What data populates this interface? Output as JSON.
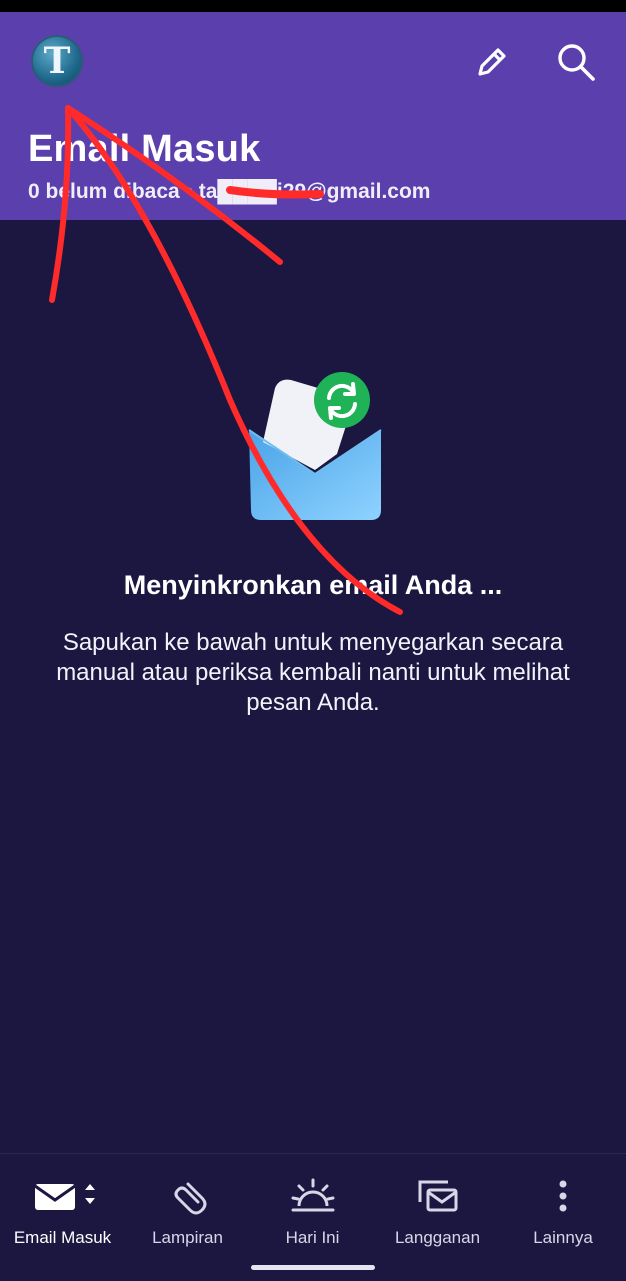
{
  "header": {
    "avatar_letter": "T",
    "title": "Email Masuk",
    "subtitle": "0 belum dibaca • ta████i29@gmail.com",
    "compose_icon": "pencil-icon",
    "search_icon": "search-icon",
    "background_color": "#5b3fad"
  },
  "main": {
    "illustration_icon": "envelope-sync-icon",
    "title": "Menyinkronkan email Anda ...",
    "description": "Sapukan ke bawah untuk menyegarkan secara manual atau periksa kembali nanti untuk melihat pesan Anda.",
    "background_color": "#1c1740"
  },
  "bottom_nav": {
    "items": [
      {
        "label": "Email Masuk",
        "icon": "mail-icon",
        "active": true
      },
      {
        "label": "Lampiran",
        "icon": "paperclip-icon",
        "active": false
      },
      {
        "label": "Hari Ini",
        "icon": "sunrise-icon",
        "active": false
      },
      {
        "label": "Langganan",
        "icon": "subscriptions-icon",
        "active": false
      },
      {
        "label": "Lainnya",
        "icon": "more-vertical-icon",
        "active": false
      }
    ]
  },
  "annotation_color": "#ff2b2b"
}
